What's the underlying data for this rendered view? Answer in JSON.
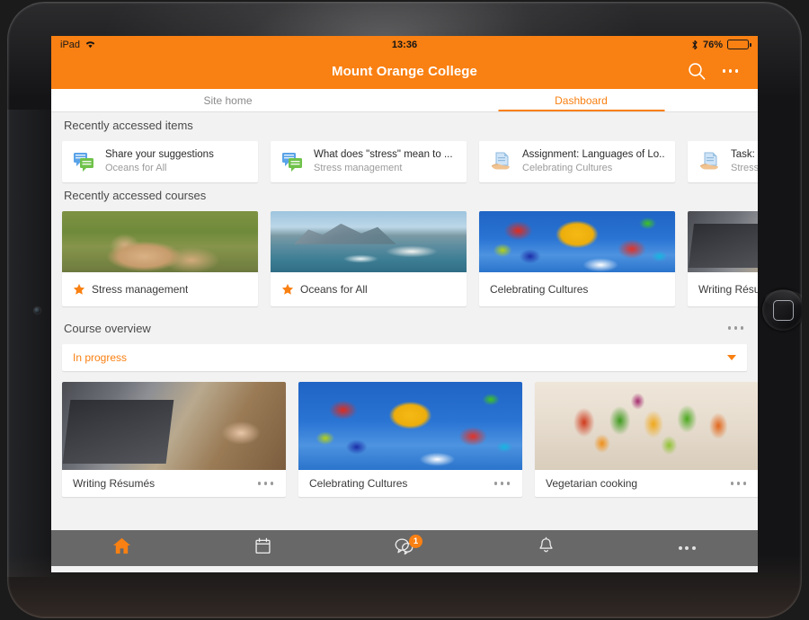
{
  "status_bar": {
    "device_label": "iPad",
    "wifi_icon": "wifi-icon",
    "time": "13:36",
    "bluetooth_icon": "bluetooth-icon",
    "battery_percent": "76%",
    "battery_icon": "battery-icon"
  },
  "header": {
    "title": "Mount Orange College",
    "search_icon": "search-icon",
    "more_icon": "more-options-icon"
  },
  "tabs": [
    {
      "label": "Site home",
      "active": false
    },
    {
      "label": "Dashboard",
      "active": true
    }
  ],
  "recently_accessed_items": {
    "section_title": "Recently accessed items",
    "items": [
      {
        "title": "Share your suggestions",
        "subtitle": "Oceans for All",
        "icon": "forum-icon"
      },
      {
        "title": "What does \"stress\" mean to ...",
        "subtitle": "Stress management",
        "icon": "forum-icon"
      },
      {
        "title": "Assignment: Languages of Lo...",
        "subtitle": "Celebrating Cultures",
        "icon": "assignment-icon"
      },
      {
        "title": "Task: So",
        "subtitle": "Stress m",
        "icon": "assignment-icon"
      }
    ]
  },
  "recently_accessed_courses": {
    "section_title": "Recently accessed courses",
    "courses": [
      {
        "name": "Stress management",
        "starred": true,
        "image": "lions-photo"
      },
      {
        "name": "Oceans for All",
        "starred": true,
        "image": "boat-lake-photo"
      },
      {
        "name": "Celebrating Cultures",
        "starred": false,
        "image": "umbrellas-photo"
      },
      {
        "name": "Writing Résumés",
        "starred": false,
        "image": "laptop-desk-photo"
      }
    ]
  },
  "course_overview": {
    "section_title": "Course overview",
    "more_icon": "more-options-icon",
    "filter": {
      "selected": "In progress",
      "caret_icon": "chevron-down-icon"
    },
    "cards": [
      {
        "name": "Writing Résumés",
        "image": "laptop-desk-photo",
        "menu_icon": "more-options-icon"
      },
      {
        "name": "Celebrating Cultures",
        "image": "umbrellas-photo",
        "menu_icon": "more-options-icon"
      },
      {
        "name": "Vegetarian cooking",
        "image": "vegetable-skewers-photo",
        "menu_icon": "more-options-icon"
      }
    ]
  },
  "tabbar": [
    {
      "name": "home",
      "icon": "home-icon",
      "active": true,
      "badge": null
    },
    {
      "name": "calendar",
      "icon": "calendar-icon",
      "active": false,
      "badge": null
    },
    {
      "name": "messages",
      "icon": "messages-icon",
      "active": false,
      "badge": "1"
    },
    {
      "name": "notifications",
      "icon": "bell-icon",
      "active": false,
      "badge": null
    },
    {
      "name": "more",
      "icon": "more-options-icon",
      "active": false,
      "badge": null
    }
  ],
  "colors": {
    "brand_orange": "#F98012",
    "tabbar_grey": "#686868",
    "page_background": "#f2f2f2"
  }
}
